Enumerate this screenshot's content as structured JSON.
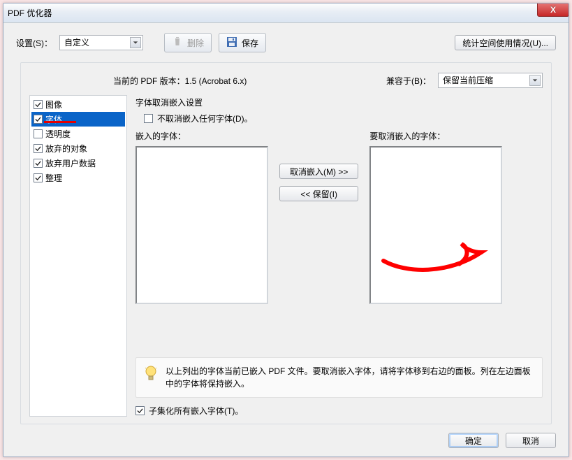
{
  "title": "PDF 优化器",
  "close_x": "X",
  "toolbar": {
    "settings_label": "设置(S)：",
    "settings_value": "自定义",
    "delete_label": "删除",
    "save_label": "保存",
    "audit_label": "统计空间使用情况(U)..."
  },
  "version": {
    "current_label": "当前的 PDF 版本：1.5 (Acrobat 6.x)",
    "compat_label": "兼容于(B)：",
    "compat_value": "保留当前压缩"
  },
  "categories": {
    "images": "图像",
    "fonts": "字体",
    "transparency": "透明度",
    "discard_objects": "放弃的对象",
    "discard_userdata": "放弃用户数据",
    "cleanup": "整理"
  },
  "fontpanel": {
    "heading": "字体取消嵌入设置",
    "no_unembed": "不取消嵌入任何字体(D)。",
    "embedded_label": "嵌入的字体：",
    "unembed_label": "要取消嵌入的字体：",
    "btn_unembed": "取消嵌入(M) >>",
    "btn_keep": "<< 保留(I)",
    "info": "以上列出的字体当前已嵌入 PDF 文件。要取消嵌入字体，请将字体移到右边的面板。列在左边面板中的字体将保持嵌入。",
    "subset": "子集化所有嵌入字体(T)。"
  },
  "footer": {
    "ok": "确定",
    "cancel": "取消"
  }
}
